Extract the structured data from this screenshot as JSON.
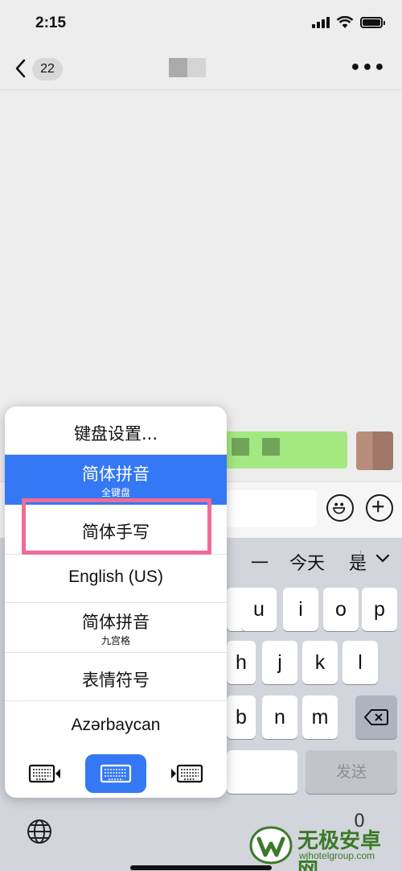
{
  "status_bar": {
    "time": "2:15"
  },
  "nav": {
    "unread_count": "22"
  },
  "keyboard": {
    "candidates": [
      "一",
      "今天",
      "是"
    ],
    "row2": [
      "u",
      "i",
      "o",
      "p"
    ],
    "row3": [
      "h",
      "j",
      "k",
      "l"
    ],
    "row4": [
      "b",
      "n",
      "m"
    ],
    "send_label": "发送",
    "mic_partial": "0"
  },
  "switcher": {
    "options": [
      {
        "label": "键盘设置...",
        "sub": ""
      },
      {
        "label": "简体拼音",
        "sub": "全键盘",
        "selected": true
      },
      {
        "label": "简体手写",
        "sub": ""
      },
      {
        "label": "English (US)",
        "sub": ""
      },
      {
        "label": "简体拼音",
        "sub": "九宫格"
      },
      {
        "label": "表情符号",
        "sub": ""
      },
      {
        "label": "Azərbaycan",
        "sub": ""
      }
    ],
    "layout_buttons": [
      "left-keyboard",
      "full-keyboard",
      "right-keyboard"
    ],
    "active_layout": "full-keyboard"
  },
  "colors": {
    "accent": "#3478f6",
    "highlight": "#f06b95",
    "bubble": "#a3e880"
  },
  "watermark": {
    "name": "无极安卓网",
    "url": "wjhotelgroup.com"
  }
}
